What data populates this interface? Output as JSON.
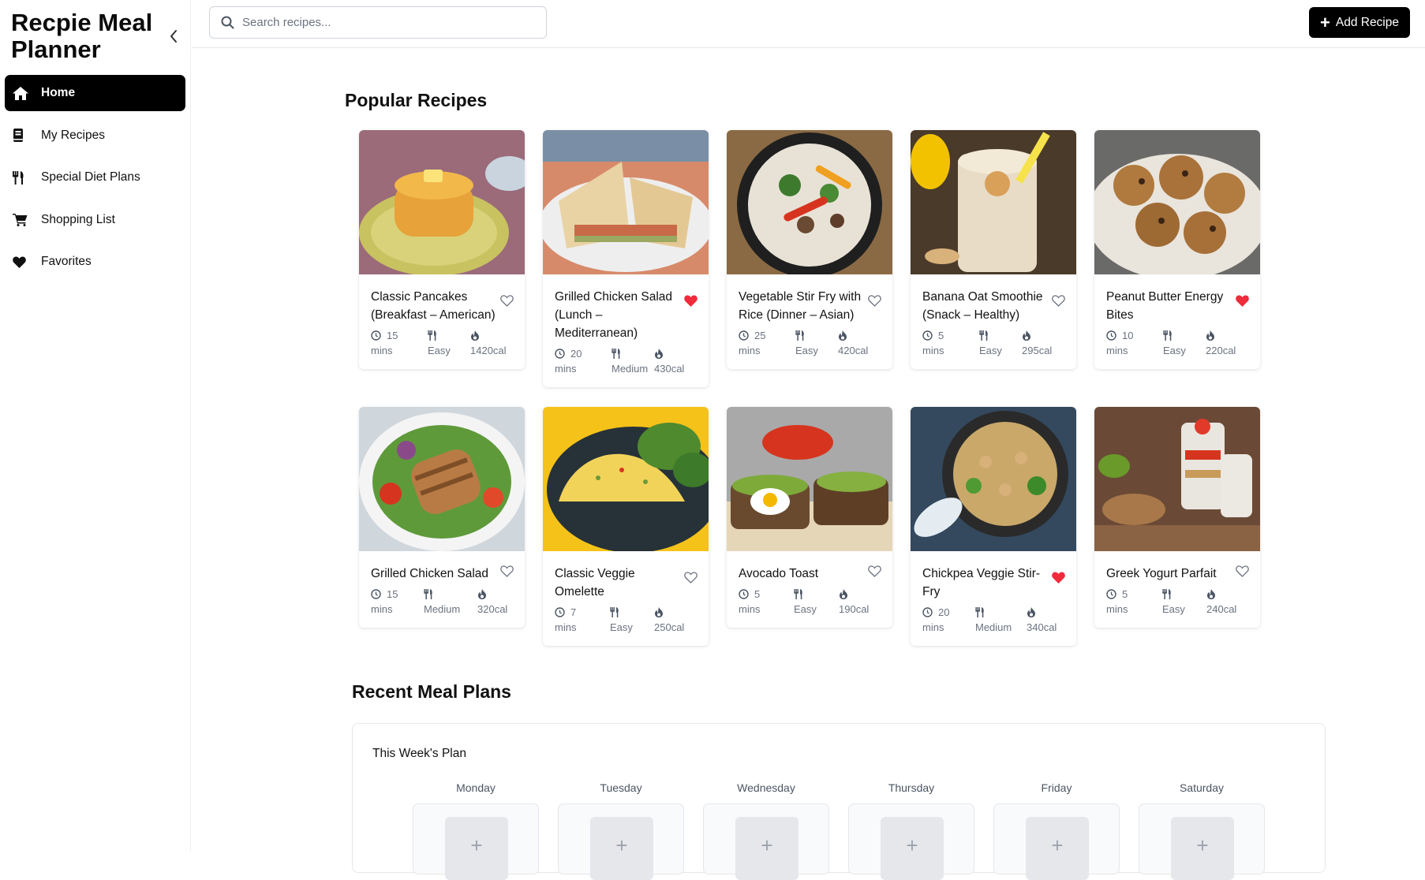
{
  "app": {
    "title": "Recpie Meal Planner"
  },
  "sidebar": {
    "items": [
      {
        "label": "Home",
        "icon": "home-icon",
        "active": true
      },
      {
        "label": "My Recipes",
        "icon": "book-icon",
        "active": false
      },
      {
        "label": "Special Diet Plans",
        "icon": "utensils-icon",
        "active": false
      },
      {
        "label": "Shopping List",
        "icon": "cart-icon",
        "active": false
      },
      {
        "label": "Favorites",
        "icon": "heart-icon",
        "active": false
      }
    ]
  },
  "topbar": {
    "search_placeholder": "Search recipes...",
    "add_button": "Add Recipe"
  },
  "popular": {
    "title": "Popular Recipes",
    "recipes": [
      {
        "name": "Classic Pancakes (Breakfast – American)",
        "time": "15",
        "time_unit": "mins",
        "difficulty": "Easy",
        "calories": "1420cal",
        "favorite": false,
        "image": "pancakes-image"
      },
      {
        "name": "Grilled Chicken Salad (Lunch – Mediterranean)",
        "time": "20",
        "time_unit": "mins",
        "difficulty": "Medium",
        "calories": "430cal",
        "favorite": true,
        "image": "sandwich-image"
      },
      {
        "name": "Vegetable Stir Fry with Rice (Dinner – Asian)",
        "time": "25",
        "time_unit": "mins",
        "difficulty": "Easy",
        "calories": "420cal",
        "favorite": false,
        "image": "stir-fry-image"
      },
      {
        "name": "Banana Oat Smoothie (Snack – Healthy)",
        "time": "5",
        "time_unit": "mins",
        "difficulty": "Easy",
        "calories": "295cal",
        "favorite": false,
        "image": "smoothie-image"
      },
      {
        "name": "Peanut Butter Energy Bites",
        "time": "10",
        "time_unit": "mins",
        "difficulty": "Easy",
        "calories": "220cal",
        "favorite": true,
        "image": "energy-bites-image"
      },
      {
        "name": "Grilled Chicken Salad",
        "time": "15",
        "time_unit": "mins",
        "difficulty": "Medium",
        "calories": "320cal",
        "favorite": false,
        "image": "chicken-salad-image"
      },
      {
        "name": "Classic Veggie Omelette",
        "time": "7",
        "time_unit": "mins",
        "difficulty": "Easy",
        "calories": "250cal",
        "favorite": false,
        "image": "omelette-image"
      },
      {
        "name": "Avocado Toast",
        "time": "5",
        "time_unit": "mins",
        "difficulty": "Easy",
        "calories": "190cal",
        "favorite": false,
        "image": "avocado-toast-image"
      },
      {
        "name": "Chickpea Veggie Stir-Fry",
        "time": "20",
        "time_unit": "mins",
        "difficulty": "Medium",
        "calories": "340cal",
        "favorite": true,
        "image": "chickpea-image"
      },
      {
        "name": "Greek Yogurt Parfait",
        "time": "5",
        "time_unit": "mins",
        "difficulty": "Easy",
        "calories": "240cal",
        "favorite": false,
        "image": "parfait-image"
      }
    ]
  },
  "meal_plans": {
    "title": "Recent Meal Plans",
    "plan_title": "This Week's Plan",
    "days": [
      "Monday",
      "Tuesday",
      "Wednesday",
      "Thursday",
      "Friday",
      "Saturday"
    ],
    "add_symbol": "+"
  },
  "colors": {
    "accent": "#000000",
    "favorite": "#ef2b3c",
    "muted": "#6b7280"
  }
}
